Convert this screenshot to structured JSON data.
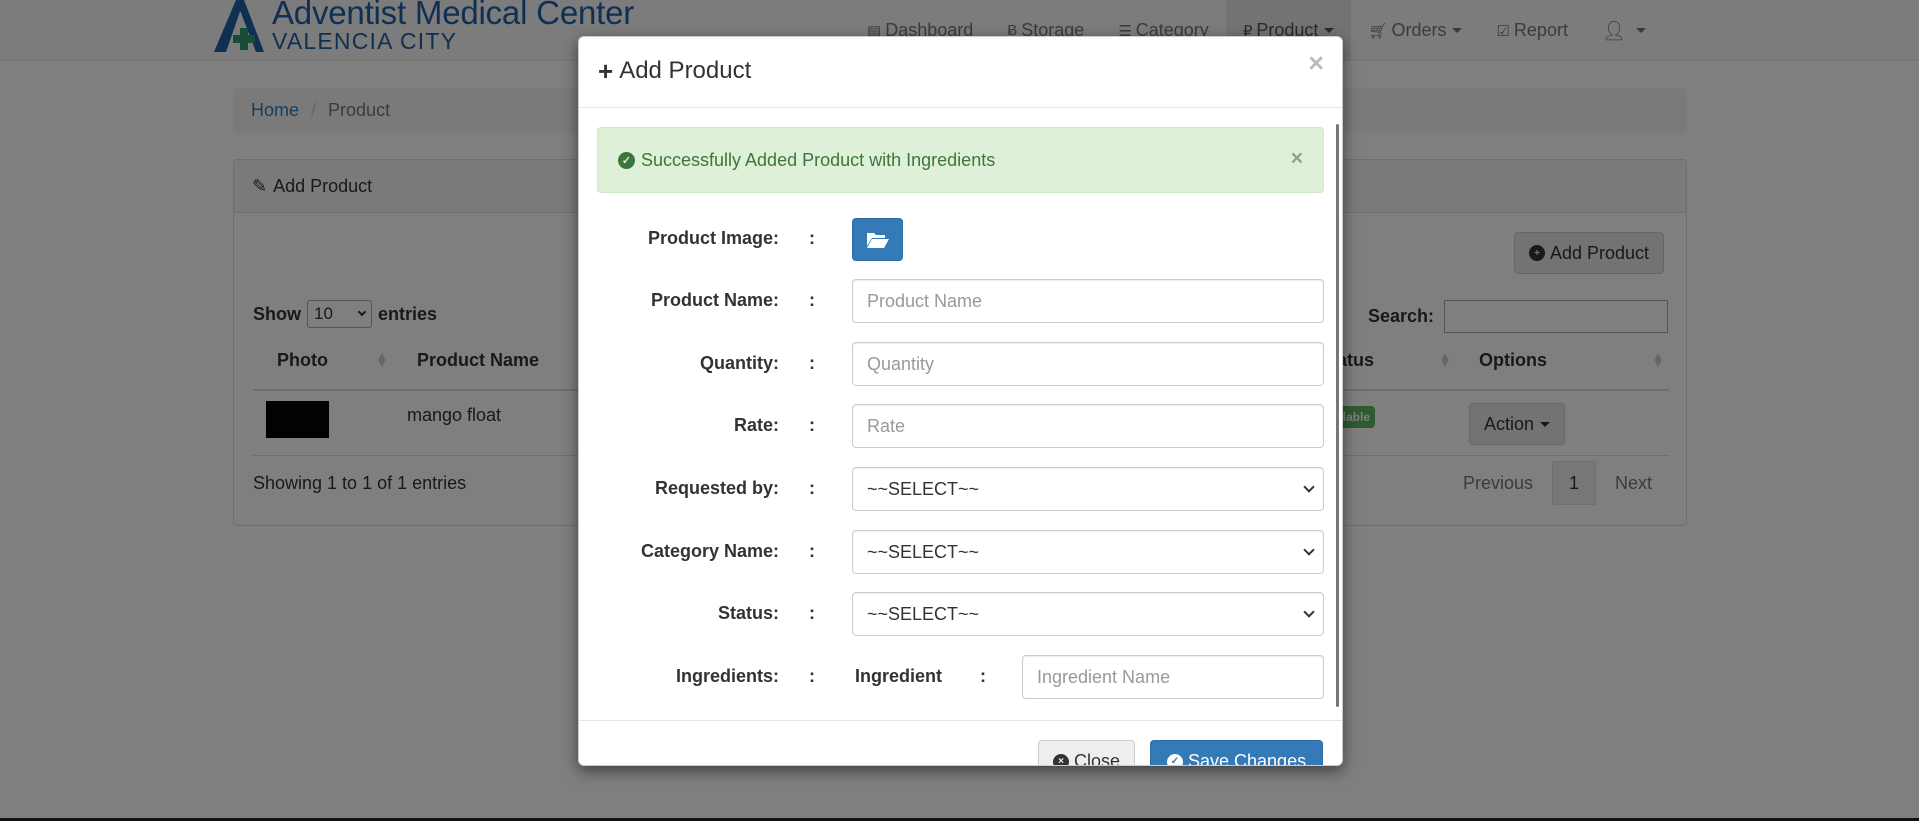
{
  "brand": {
    "line1": "Adventist Medical Center",
    "line2": "VALENCIA CITY"
  },
  "nav": {
    "items": [
      {
        "label": "Dashboard",
        "icon": "dashboard-icon"
      },
      {
        "label": "Storage",
        "icon": "bitcoin-icon"
      },
      {
        "label": "Category",
        "icon": "list-icon"
      },
      {
        "label": "Product",
        "icon": "ruble-icon",
        "active": true
      },
      {
        "label": "Orders",
        "icon": "cart-icon"
      },
      {
        "label": "Report",
        "icon": "check-square-icon"
      }
    ],
    "user_icon": "user-icon"
  },
  "breadcrumb": {
    "home": "Home",
    "current": "Product"
  },
  "panel": {
    "heading": "Add Product",
    "add_button": "Add Product",
    "show_label": "Show",
    "entries_value": "10",
    "entries_label": "entries",
    "search_label": "Search:",
    "columns": {
      "photo": "Photo",
      "product_name": "Product Name",
      "status": "atus",
      "options": "Options"
    },
    "row": {
      "name": "mango float",
      "status_badge": "ailable",
      "action": "Action"
    },
    "showing": "Showing 1 to 1 of 1 entries",
    "pagination": {
      "previous": "Previous",
      "page": "1",
      "next": "Next"
    }
  },
  "modal": {
    "title": "Add Product",
    "close_x": "×",
    "alert": {
      "message": "Successfully Added Product with Ingredients",
      "close": "×"
    },
    "fields": {
      "image_label": "Product Image:",
      "name_label": "Product Name:",
      "name_placeholder": "Product Name",
      "quantity_label": "Quantity:",
      "quantity_placeholder": "Quantity",
      "rate_label": "Rate:",
      "rate_placeholder": "Rate",
      "requested_label": "Requested by:",
      "requested_value": "~~SELECT~~",
      "category_label": "Category Name:",
      "category_value": "~~SELECT~~",
      "status_label": "Status:",
      "status_value": "~~SELECT~~",
      "ingredients_label": "Ingredients:",
      "ingredient_sub_label": "Ingredient",
      "ingredient_placeholder": "Ingredient Name",
      "colon": ":"
    },
    "buttons": {
      "close": "Close",
      "save": "Save Changes"
    }
  },
  "colors": {
    "primary": "#337ab7",
    "success_bg": "#dff0d8",
    "success_text": "#3c763d",
    "badge_green": "#5cb85c",
    "brand_blue": "#1f5fa6",
    "brand_green": "#2e9a6e"
  }
}
